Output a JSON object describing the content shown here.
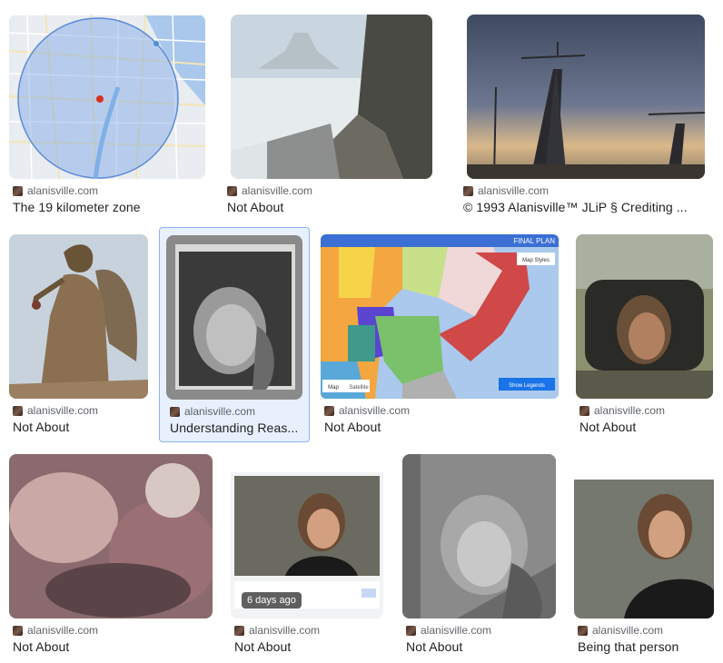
{
  "results": [
    {
      "source": "alanisville.com",
      "title": "The 19 kilometer zone"
    },
    {
      "source": "alanisville.com",
      "title": "Not About"
    },
    {
      "source": "alanisville.com",
      "title": "© 1993 Alanisville™ JLiP § Crediting ..."
    },
    {
      "source": "alanisville.com",
      "title": "Not About"
    },
    {
      "source": "alanisville.com",
      "title": "Understanding Reas..."
    },
    {
      "source": "alanisville.com",
      "title": "Not About"
    },
    {
      "source": "alanisville.com",
      "title": "Not About"
    },
    {
      "source": "alanisville.com",
      "title": "Not About"
    },
    {
      "source": "alanisville.com",
      "title": "Not About",
      "badge": "6 days ago"
    },
    {
      "source": "alanisville.com",
      "title": "Not About"
    },
    {
      "source": "alanisville.com",
      "title": "Being that person"
    }
  ],
  "map_labels": {
    "final_plan": "FINAL PLAN",
    "map_styles": "Map Styles",
    "map_btn": "Map",
    "satellite_btn": "Satellite",
    "show_legends": "Show Legends"
  }
}
